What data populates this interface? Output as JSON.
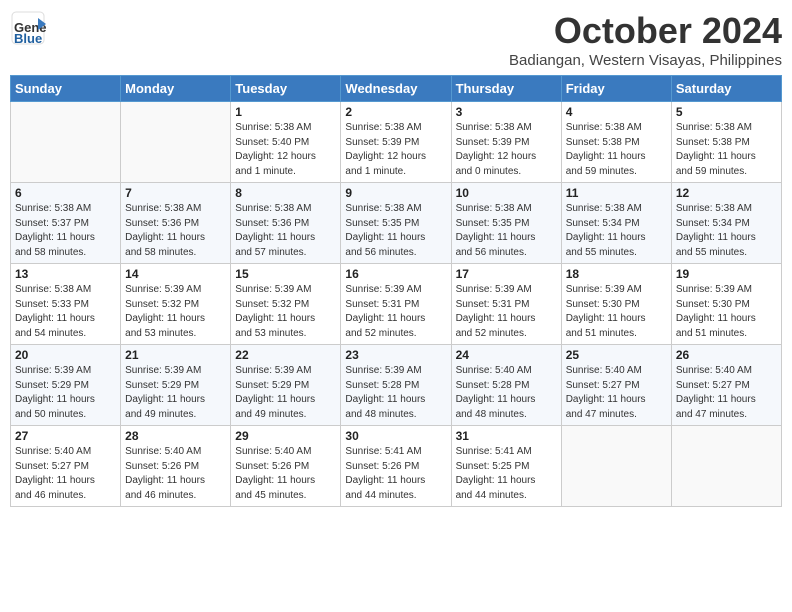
{
  "header": {
    "logo_general": "General",
    "logo_blue": "Blue",
    "month": "October 2024",
    "location": "Badiangan, Western Visayas, Philippines"
  },
  "weekdays": [
    "Sunday",
    "Monday",
    "Tuesday",
    "Wednesday",
    "Thursday",
    "Friday",
    "Saturday"
  ],
  "weeks": [
    [
      {
        "day": "",
        "info": ""
      },
      {
        "day": "",
        "info": ""
      },
      {
        "day": "1",
        "info": "Sunrise: 5:38 AM\nSunset: 5:40 PM\nDaylight: 12 hours\nand 1 minute."
      },
      {
        "day": "2",
        "info": "Sunrise: 5:38 AM\nSunset: 5:39 PM\nDaylight: 12 hours\nand 1 minute."
      },
      {
        "day": "3",
        "info": "Sunrise: 5:38 AM\nSunset: 5:39 PM\nDaylight: 12 hours\nand 0 minutes."
      },
      {
        "day": "4",
        "info": "Sunrise: 5:38 AM\nSunset: 5:38 PM\nDaylight: 11 hours\nand 59 minutes."
      },
      {
        "day": "5",
        "info": "Sunrise: 5:38 AM\nSunset: 5:38 PM\nDaylight: 11 hours\nand 59 minutes."
      }
    ],
    [
      {
        "day": "6",
        "info": "Sunrise: 5:38 AM\nSunset: 5:37 PM\nDaylight: 11 hours\nand 58 minutes."
      },
      {
        "day": "7",
        "info": "Sunrise: 5:38 AM\nSunset: 5:36 PM\nDaylight: 11 hours\nand 58 minutes."
      },
      {
        "day": "8",
        "info": "Sunrise: 5:38 AM\nSunset: 5:36 PM\nDaylight: 11 hours\nand 57 minutes."
      },
      {
        "day": "9",
        "info": "Sunrise: 5:38 AM\nSunset: 5:35 PM\nDaylight: 11 hours\nand 56 minutes."
      },
      {
        "day": "10",
        "info": "Sunrise: 5:38 AM\nSunset: 5:35 PM\nDaylight: 11 hours\nand 56 minutes."
      },
      {
        "day": "11",
        "info": "Sunrise: 5:38 AM\nSunset: 5:34 PM\nDaylight: 11 hours\nand 55 minutes."
      },
      {
        "day": "12",
        "info": "Sunrise: 5:38 AM\nSunset: 5:34 PM\nDaylight: 11 hours\nand 55 minutes."
      }
    ],
    [
      {
        "day": "13",
        "info": "Sunrise: 5:38 AM\nSunset: 5:33 PM\nDaylight: 11 hours\nand 54 minutes."
      },
      {
        "day": "14",
        "info": "Sunrise: 5:39 AM\nSunset: 5:32 PM\nDaylight: 11 hours\nand 53 minutes."
      },
      {
        "day": "15",
        "info": "Sunrise: 5:39 AM\nSunset: 5:32 PM\nDaylight: 11 hours\nand 53 minutes."
      },
      {
        "day": "16",
        "info": "Sunrise: 5:39 AM\nSunset: 5:31 PM\nDaylight: 11 hours\nand 52 minutes."
      },
      {
        "day": "17",
        "info": "Sunrise: 5:39 AM\nSunset: 5:31 PM\nDaylight: 11 hours\nand 52 minutes."
      },
      {
        "day": "18",
        "info": "Sunrise: 5:39 AM\nSunset: 5:30 PM\nDaylight: 11 hours\nand 51 minutes."
      },
      {
        "day": "19",
        "info": "Sunrise: 5:39 AM\nSunset: 5:30 PM\nDaylight: 11 hours\nand 51 minutes."
      }
    ],
    [
      {
        "day": "20",
        "info": "Sunrise: 5:39 AM\nSunset: 5:29 PM\nDaylight: 11 hours\nand 50 minutes."
      },
      {
        "day": "21",
        "info": "Sunrise: 5:39 AM\nSunset: 5:29 PM\nDaylight: 11 hours\nand 49 minutes."
      },
      {
        "day": "22",
        "info": "Sunrise: 5:39 AM\nSunset: 5:29 PM\nDaylight: 11 hours\nand 49 minutes."
      },
      {
        "day": "23",
        "info": "Sunrise: 5:39 AM\nSunset: 5:28 PM\nDaylight: 11 hours\nand 48 minutes."
      },
      {
        "day": "24",
        "info": "Sunrise: 5:40 AM\nSunset: 5:28 PM\nDaylight: 11 hours\nand 48 minutes."
      },
      {
        "day": "25",
        "info": "Sunrise: 5:40 AM\nSunset: 5:27 PM\nDaylight: 11 hours\nand 47 minutes."
      },
      {
        "day": "26",
        "info": "Sunrise: 5:40 AM\nSunset: 5:27 PM\nDaylight: 11 hours\nand 47 minutes."
      }
    ],
    [
      {
        "day": "27",
        "info": "Sunrise: 5:40 AM\nSunset: 5:27 PM\nDaylight: 11 hours\nand 46 minutes."
      },
      {
        "day": "28",
        "info": "Sunrise: 5:40 AM\nSunset: 5:26 PM\nDaylight: 11 hours\nand 46 minutes."
      },
      {
        "day": "29",
        "info": "Sunrise: 5:40 AM\nSunset: 5:26 PM\nDaylight: 11 hours\nand 45 minutes."
      },
      {
        "day": "30",
        "info": "Sunrise: 5:41 AM\nSunset: 5:26 PM\nDaylight: 11 hours\nand 44 minutes."
      },
      {
        "day": "31",
        "info": "Sunrise: 5:41 AM\nSunset: 5:25 PM\nDaylight: 11 hours\nand 44 minutes."
      },
      {
        "day": "",
        "info": ""
      },
      {
        "day": "",
        "info": ""
      }
    ]
  ]
}
